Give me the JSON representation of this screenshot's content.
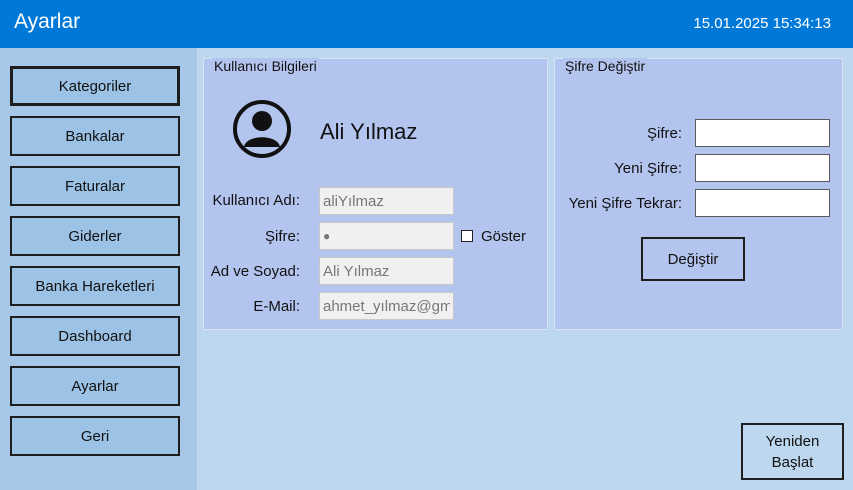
{
  "titlebar": {
    "title": "Ayarlar",
    "datetime": "15.01.2025 15:34:13"
  },
  "sidebar": {
    "items": [
      {
        "label": "Kategoriler",
        "active": true
      },
      {
        "label": "Bankalar"
      },
      {
        "label": "Faturalar"
      },
      {
        "label": "Giderler"
      },
      {
        "label": "Banka Hareketleri"
      },
      {
        "label": "Dashboard"
      },
      {
        "label": "Ayarlar"
      },
      {
        "label": "Geri"
      }
    ]
  },
  "user_info": {
    "title": "Kullanıcı Bilgileri",
    "display_name": "Ali Yılmaz",
    "username_label": "Kullanıcı Adı:",
    "username_value": "aliYılmaz",
    "password_label": "Şifre:",
    "password_value": "●",
    "show_label": "Göster",
    "fullname_label": "Ad ve Soyad:",
    "fullname_value": "Ali Yılmaz",
    "email_label": "E-Mail:",
    "email_value": "ahmet_yılmaz@gm"
  },
  "change_password": {
    "title": "Şifre Değiştir",
    "password_label": "Şifre:",
    "new_password_label": "Yeni Şifre:",
    "confirm_label": "Yeni Şifre Tekrar:",
    "submit_label": "Değiştir"
  },
  "restart": {
    "line1": "Yeniden",
    "line2": "Başlat"
  },
  "colors": {
    "titlebar": "#0078d7",
    "sidebar": "#a7c7e8",
    "panel": "#b3c4ee",
    "background": "#bdd7ee"
  }
}
